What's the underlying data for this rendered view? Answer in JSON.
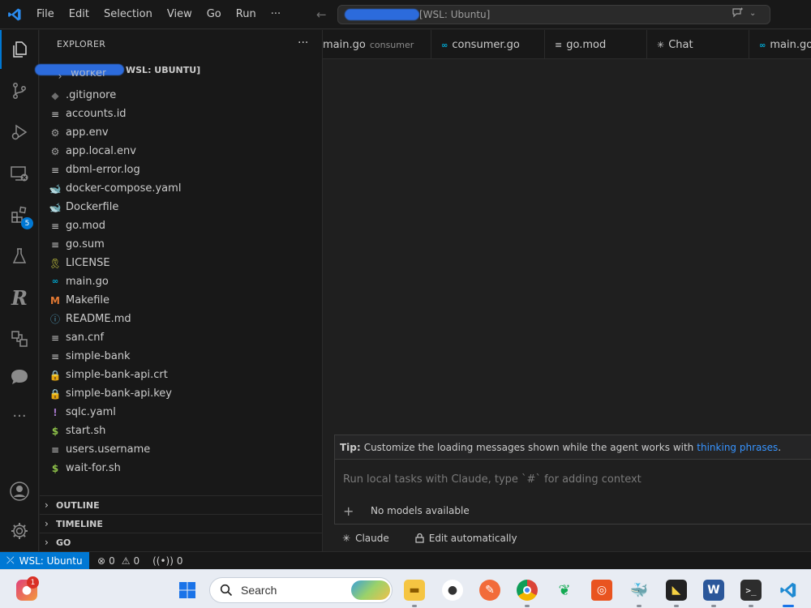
{
  "titlebar": {
    "menu": [
      "File",
      "Edit",
      "Selection",
      "View",
      "Go",
      "Run"
    ],
    "more": "···",
    "command_center_text": "[WSL: Ubuntu]"
  },
  "activitybar": {
    "extensions_badge": "5"
  },
  "sidebar": {
    "title": "EXPLORER",
    "more": "···",
    "root_label": "WSL: UBUNTU]",
    "partial_item": "worker",
    "files": [
      {
        "name": ".gitignore",
        "icon": "git-icon"
      },
      {
        "name": "accounts.id",
        "icon": "lines-icon"
      },
      {
        "name": "app.env",
        "icon": "gear-icon"
      },
      {
        "name": "app.local.env",
        "icon": "gear-icon"
      },
      {
        "name": "dbml-error.log",
        "icon": "lines-icon"
      },
      {
        "name": "docker-compose.yaml",
        "icon": "docker-icon"
      },
      {
        "name": "Dockerfile",
        "icon": "docker-icon"
      },
      {
        "name": "go.mod",
        "icon": "lines-icon"
      },
      {
        "name": "go.sum",
        "icon": "lines-icon"
      },
      {
        "name": "LICENSE",
        "icon": "license-icon"
      },
      {
        "name": "main.go",
        "icon": "go-icon"
      },
      {
        "name": "Makefile",
        "icon": "makefile-icon"
      },
      {
        "name": "README.md",
        "icon": "info-icon"
      },
      {
        "name": "san.cnf",
        "icon": "lines-icon"
      },
      {
        "name": "simple-bank",
        "icon": "lines-icon"
      },
      {
        "name": "simple-bank-api.crt",
        "icon": "lock-icon"
      },
      {
        "name": "simple-bank-api.key",
        "icon": "lock-icon"
      },
      {
        "name": "sqlc.yaml",
        "icon": "exclaim-icon"
      },
      {
        "name": "start.sh",
        "icon": "dollar-icon"
      },
      {
        "name": "users.username",
        "icon": "lines-icon"
      },
      {
        "name": "wait-for.sh",
        "icon": "dollar-icon"
      }
    ],
    "sections": [
      "OUTLINE",
      "TIMELINE",
      "GO"
    ]
  },
  "tabs": [
    {
      "label": "main.go",
      "desc": "consumer",
      "icon": "none"
    },
    {
      "label": "consumer.go",
      "desc": "",
      "icon": "go-icon"
    },
    {
      "label": "go.mod",
      "desc": "",
      "icon": "lines-icon"
    },
    {
      "label": "Chat",
      "desc": "",
      "icon": "sparkle-icon"
    },
    {
      "label": "main.go",
      "desc": "",
      "icon": "go-icon"
    }
  ],
  "chat": {
    "tip_label": "Tip:",
    "tip_text": "Customize the loading messages shown while the agent works with",
    "tip_link": "thinking phrases",
    "tip_end": ".",
    "input_placeholder": "Run local tasks with Claude, type `#` for adding context",
    "plus": "+",
    "model": "No models available",
    "footer_agent": "Claude",
    "footer_mode": "Edit automatically"
  },
  "statusbar": {
    "remote": "WSL: Ubuntu",
    "errors": "0",
    "warnings": "0",
    "ports": "0"
  },
  "taskbar": {
    "search_label": "Search",
    "notification_count": "1"
  },
  "colors": {
    "accent": "#0078d4",
    "link": "#3794ff",
    "go": "#00add8",
    "docker": "#2496ed",
    "makefile": "#e37933",
    "lock": "#8dc149",
    "license": "#cbcb41",
    "exclaim": "#a074c4"
  }
}
